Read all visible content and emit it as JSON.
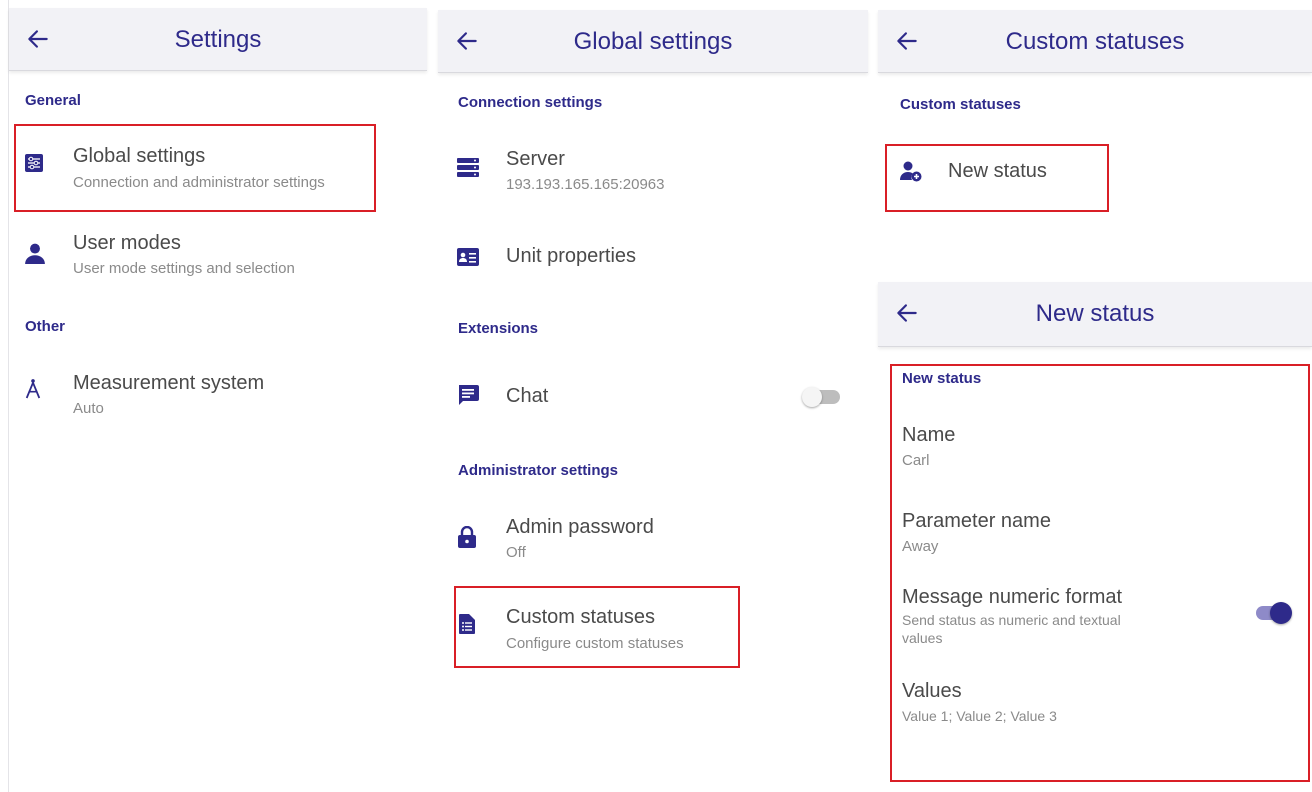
{
  "colors": {
    "accent": "#2e2a8a",
    "highlight": "#d91f26",
    "appbar_bg": "#f2f2f6"
  },
  "settings": {
    "title": "Settings",
    "sections": {
      "general": "General",
      "other": "Other"
    },
    "global_settings": {
      "title": "Global settings",
      "subtitle": "Connection and administrator settings",
      "icon": "sliders-icon"
    },
    "user_modes": {
      "title": "User modes",
      "subtitle": "User mode settings and selection",
      "icon": "person-icon"
    },
    "measurement": {
      "title": "Measurement system",
      "subtitle": "Auto",
      "icon": "compass-icon"
    }
  },
  "global": {
    "title": "Global settings",
    "sections": {
      "connection": "Connection settings",
      "extensions": "Extensions",
      "admin": "Administrator settings"
    },
    "server": {
      "title": "Server",
      "subtitle": "193.193.165.165:20963",
      "icon": "server-icon"
    },
    "unit": {
      "title": "Unit properties",
      "icon": "id-card-icon"
    },
    "chat": {
      "title": "Chat",
      "enabled": false,
      "icon": "chat-icon"
    },
    "admin_password": {
      "title": "Admin password",
      "subtitle": "Off",
      "icon": "lock-icon"
    },
    "custom_statuses": {
      "title": "Custom statuses",
      "subtitle": "Configure custom statuses",
      "icon": "document-list-icon"
    }
  },
  "custom": {
    "title": "Custom statuses",
    "section": "Custom statuses",
    "new_status": {
      "title": "New status",
      "icon": "add-user-icon"
    }
  },
  "new_status": {
    "title": "New status",
    "section": "New status",
    "name": {
      "title": "Name",
      "value": "Carl"
    },
    "parameter": {
      "title": "Parameter name",
      "value": "Away"
    },
    "numeric": {
      "title": "Message numeric format",
      "subtitle_line1": "Send status as numeric and textual",
      "subtitle_line2": "values",
      "enabled": true
    },
    "values": {
      "title": "Values",
      "value": "Value 1; Value 2; Value 3"
    }
  }
}
